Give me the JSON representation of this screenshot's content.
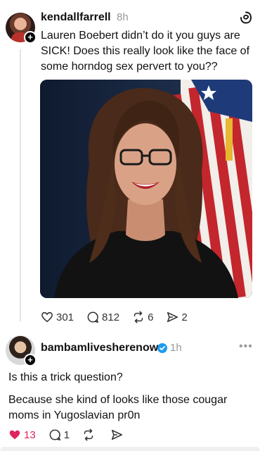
{
  "post1": {
    "username": "kendallfarrell",
    "time": "8h",
    "text": "Lauren Boebert didn’t do it you guys are SICK! Does this really look like the face of some horndog sex pervert to you??",
    "stats": {
      "likes": "301",
      "replies": "812",
      "reposts": "6",
      "shares": "2"
    }
  },
  "post2": {
    "username": "bambamlivesherenow",
    "time": "1h",
    "line1": "Is this a trick question?",
    "line2": "Because she kind of looks like those cougar moms in Yugoslavian pr0n",
    "stats": {
      "likes": "13",
      "replies": "1"
    }
  },
  "icons": {
    "threads": "threads-logo-icon",
    "heart": "heart-icon",
    "comment": "comment-icon",
    "repost": "repost-icon",
    "share": "send-icon",
    "verified": "verified-badge-icon",
    "more": "more-icon"
  },
  "colors": {
    "like_red": "#e0245e",
    "verified_blue": "#1d9bf0"
  }
}
